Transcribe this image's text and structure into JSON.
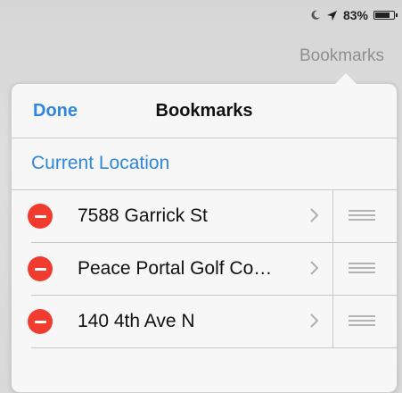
{
  "status": {
    "moon_icon": "moon-icon",
    "location_icon": "location-arrow-icon",
    "battery_percent": "83%",
    "battery_level": 0.83
  },
  "nav_tab_label": "Bookmarks",
  "popover": {
    "done_label": "Done",
    "title": "Bookmarks",
    "current_location_label": "Current Location",
    "items": [
      {
        "label": "7588 Garrick St"
      },
      {
        "label": "Peace Portal Golf Co…"
      },
      {
        "label": "140 4th Ave N"
      }
    ]
  },
  "colors": {
    "accent": "#2f87db",
    "delete": "#f23b2f",
    "separator": "#c8c7cc"
  }
}
